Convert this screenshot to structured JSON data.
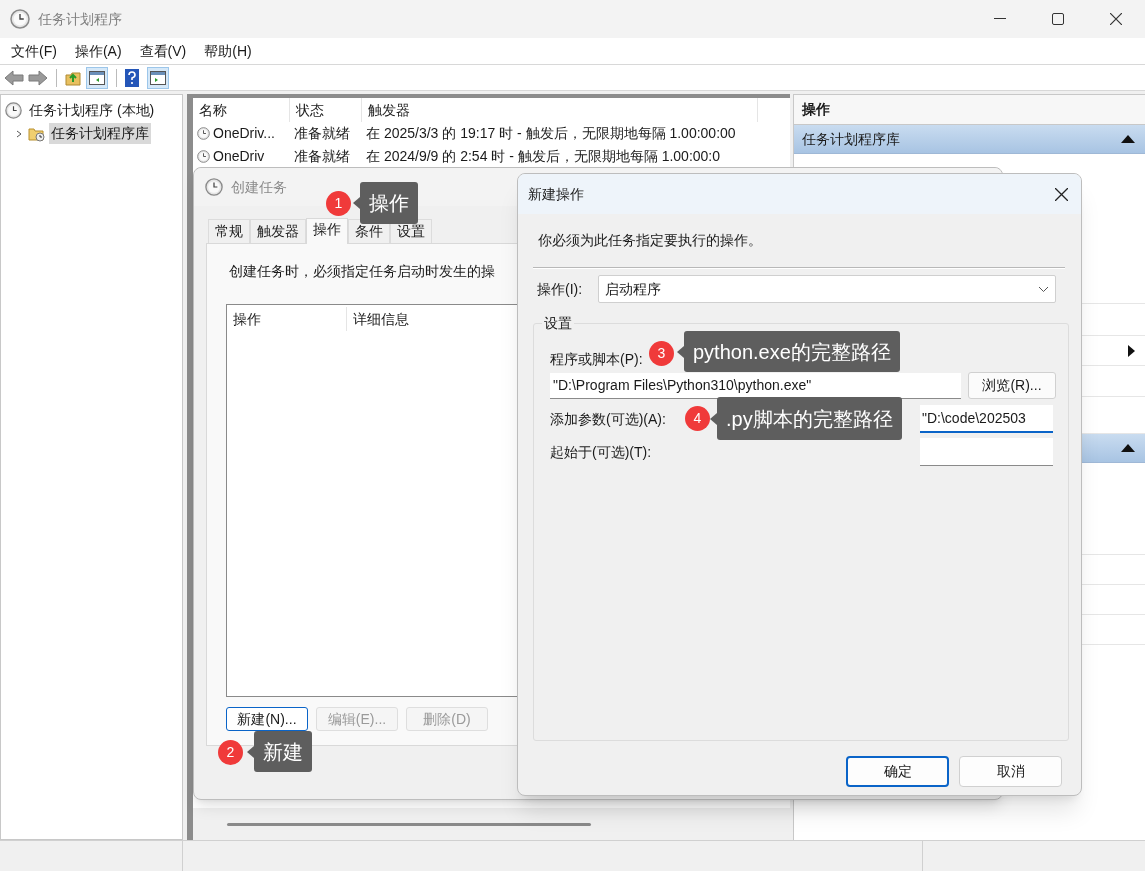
{
  "window": {
    "title": "任务计划程序"
  },
  "menu": [
    "文件(F)",
    "操作(A)",
    "查看(V)",
    "帮助(H)"
  ],
  "tree": [
    {
      "label": "任务计划程序 (本地)",
      "selected": false,
      "children": [
        {
          "label": "任务计划程序库",
          "selected": true,
          "expanded": false
        }
      ]
    }
  ],
  "task_table": {
    "columns": [
      "名称",
      "状态",
      "触发器"
    ],
    "rows": [
      [
        "OneDriv...",
        "准备就绪",
        "在 2025/3/3 的 19:17 时 - 触发后，无限期地每隔 1.00:00:00"
      ],
      [
        "OneDriv",
        "准备就绪",
        "在 2024/9/9 的 2:54 时 - 触发后，无限期地每隔 1.00:00:0"
      ]
    ]
  },
  "actions_panel": {
    "title": "操作",
    "sections": [
      {
        "title": "任务计划程序库",
        "expanded": true
      },
      {
        "expanded": true
      }
    ]
  },
  "create_task_dialog": {
    "title": "创建任务",
    "tabs": [
      {
        "label": "常规",
        "selected": false
      },
      {
        "label": "触发器",
        "selected": false
      },
      {
        "label": "操作",
        "selected": true
      },
      {
        "label": "条件",
        "selected": false
      },
      {
        "label": "设置",
        "selected": false
      }
    ],
    "description": "创建任务时，必须指定任务启动时发生的操",
    "list_columns": [
      "操作",
      "详细信息"
    ],
    "buttons": [
      {
        "label": "新建(N)...",
        "disabled": false
      },
      {
        "label": "编辑(E)...",
        "disabled": true
      },
      {
        "label": "删除(D)",
        "disabled": true
      }
    ]
  },
  "new_action_dialog": {
    "title": "新建操作",
    "instruction": "你必须为此任务指定要执行的操作。",
    "action_label": "操作(I):",
    "action_value": "启动程序",
    "group_title": "设置",
    "program_label": "程序或脚本(P):",
    "program_value": "\"D:\\Program Files\\Python310\\python.exe\"",
    "browse_button": "浏览(R)...",
    "arguments_label": "添加参数(可选)(A):",
    "arguments_value": "\"D:\\code\\202503",
    "start_in_label": "起始于(可选)(T):",
    "buttons": [
      "确定",
      "取消"
    ]
  },
  "annotations": [
    {
      "number": "1",
      "text": "操作"
    },
    {
      "number": "2",
      "text": "新建"
    },
    {
      "number": "3",
      "text": "python.exe的完整路径"
    },
    {
      "number": "4",
      "text": ".py脚本的完整路径"
    }
  ]
}
